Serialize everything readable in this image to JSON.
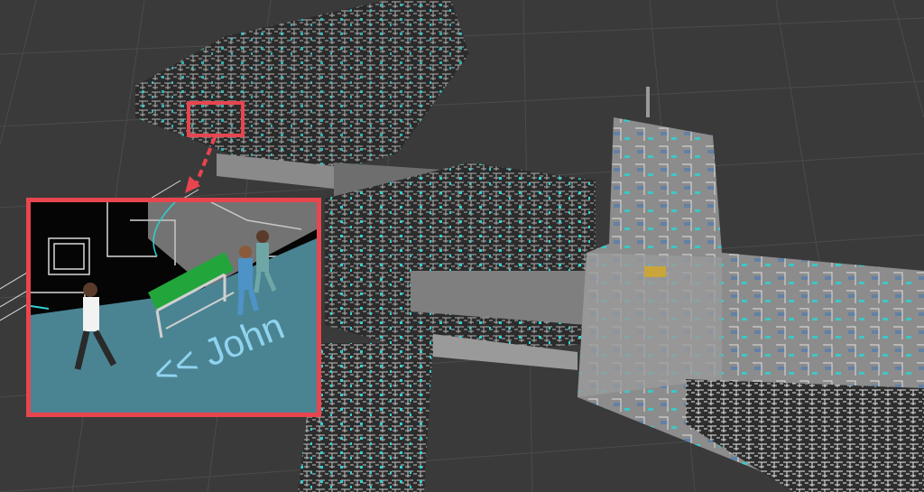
{
  "viewport": {
    "background_color": "#3a3a3a",
    "grid_color": "#4a4a4a"
  },
  "callout": {
    "border_color": "#e8454e",
    "floor_label": "<< John"
  },
  "colors": {
    "floor_highlight": "#4a8493",
    "building_gray": "#8c8c8c",
    "wall_white": "#f2f2f2",
    "marker_cyan": "#33d6d6",
    "stretcher_green": "#22a53b"
  }
}
